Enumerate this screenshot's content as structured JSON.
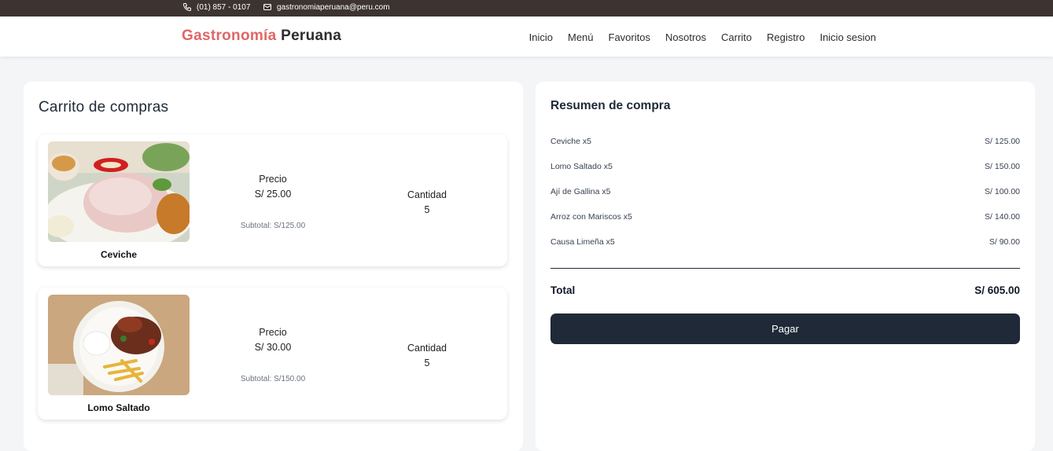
{
  "topbar": {
    "phone": "(01) 857 - 0107",
    "email": "gastronomiaperuana@peru.com"
  },
  "brand": {
    "part1": "Gastronomía",
    "part2": "Peruana",
    "accent_color": "#e06666"
  },
  "nav": [
    "Inicio",
    "Menú",
    "Favoritos",
    "Nosotros",
    "Carrito",
    "Registro",
    "Inicio sesion"
  ],
  "cart": {
    "title": "Carrito de compras",
    "items": [
      {
        "name": "Ceviche",
        "price_label": "Precio",
        "price": "S/ 25.00",
        "qty_label": "Cantidad",
        "qty": "5",
        "subtotal": "Subtotal: S/125.00"
      },
      {
        "name": "Lomo Saltado",
        "price_label": "Precio",
        "price": "S/ 30.00",
        "qty_label": "Cantidad",
        "qty": "5",
        "subtotal": "Subtotal: S/150.00"
      }
    ]
  },
  "summary": {
    "title": "Resumen de compra",
    "rows": [
      {
        "label": "Ceviche x5",
        "amount": "S/ 125.00"
      },
      {
        "label": "Lomo Saltado x5",
        "amount": "S/ 150.00"
      },
      {
        "label": "Ají de Gallina x5",
        "amount": "S/ 100.00"
      },
      {
        "label": "Arroz con Mariscos x5",
        "amount": "S/ 140.00"
      },
      {
        "label": "Causa Limeña x5",
        "amount": "S/ 90.00"
      }
    ],
    "total_label": "Total",
    "total": "S/ 605.00",
    "pay_label": "Pagar"
  }
}
